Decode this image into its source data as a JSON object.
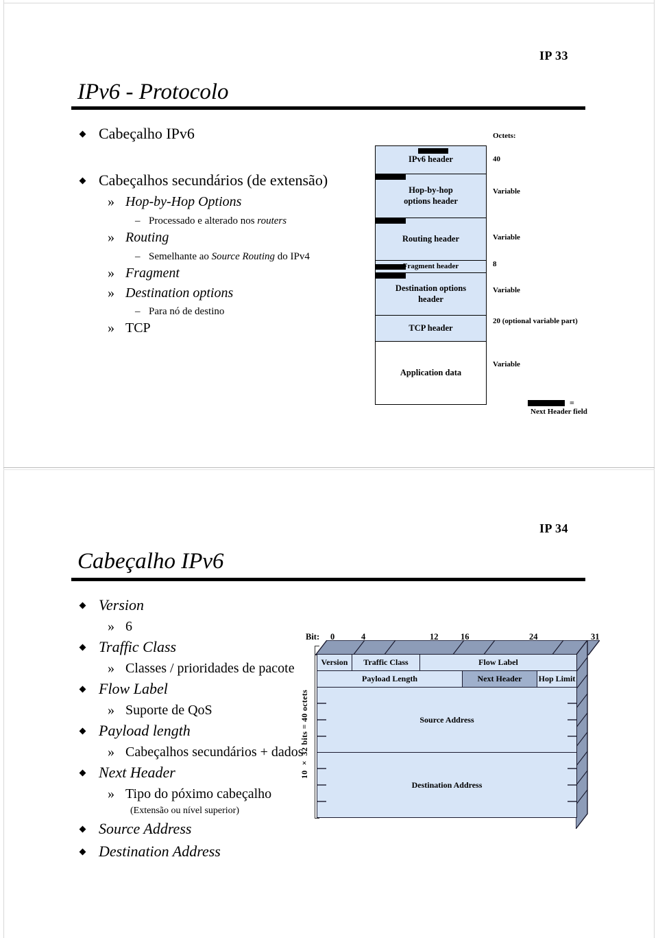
{
  "document": {
    "kind": "lecture-slides",
    "slides": [
      {
        "number_label": "IP 33",
        "title": "IPv6 - Protocolo",
        "bullets": [
          {
            "level": 1,
            "marker": "diamond",
            "text": "Cabeçalho IPv6",
            "style": "roman"
          },
          {
            "level": 1,
            "marker": "diamond",
            "text": "Cabeçalhos secundários (de extensão)",
            "style": "roman"
          },
          {
            "level": 2,
            "marker": "guillemet",
            "text": "Hop-by-Hop Options",
            "style": "italic"
          },
          {
            "level": 3,
            "marker": "dash",
            "text": "Processado e alterado nos ",
            "text_italic_tail": "routers",
            "style": "roman"
          },
          {
            "level": 2,
            "marker": "guillemet",
            "text": "Routing",
            "style": "italic"
          },
          {
            "level": 3,
            "marker": "dash",
            "text": "Semelhante ao ",
            "text_italic_mid": "Source Routing",
            "text_tail": " do IPv4",
            "style": "roman"
          },
          {
            "level": 2,
            "marker": "guillemet",
            "text": "Fragment",
            "style": "italic"
          },
          {
            "level": 2,
            "marker": "guillemet",
            "text": "Destination options",
            "style": "italic"
          },
          {
            "level": 3,
            "marker": "dash",
            "text": "Para nó de destino",
            "style": "roman"
          },
          {
            "level": 2,
            "marker": "guillemet",
            "text": "TCP",
            "style": "roman"
          }
        ],
        "diagram": {
          "type": "stack",
          "octets_header": "Octets:",
          "rows": [
            {
              "label": "IPv6 header",
              "octets": "40",
              "fill": "#d7e5f7",
              "next_header_marker": "inside-top"
            },
            {
              "label": "Hop-by-hop\noptions header",
              "octets": "Variable",
              "fill": "#d7e5f7",
              "next_header_marker": "top-left"
            },
            {
              "label": "Routing header",
              "octets": "Variable",
              "fill": "#d7e5f7",
              "next_header_marker": "top-left"
            },
            {
              "label": "Fragment header",
              "octets": "8",
              "fill": "#d7e5f7",
              "next_header_marker": "left-inline"
            },
            {
              "label": "Destination options\nheader",
              "octets": "Variable",
              "fill": "#d7e5f7",
              "next_header_marker": "top-left"
            },
            {
              "label": "TCP header",
              "octets": "20 (optional variable part)",
              "fill": "#d7e5f7",
              "next_header_marker": "none"
            },
            {
              "label": "Application data",
              "octets": "Variable",
              "fill": "#ffffff",
              "next_header_marker": "none"
            }
          ],
          "legend": {
            "equals": "=",
            "text": "Next Header field",
            "swatch_color": "#000000"
          }
        }
      },
      {
        "number_label": "IP 34",
        "title": "Cabeçalho IPv6",
        "bullets": [
          {
            "level": 1,
            "marker": "diamond",
            "text": "Version",
            "style": "italic"
          },
          {
            "level": 2,
            "marker": "guillemet",
            "text": "6",
            "style": "roman"
          },
          {
            "level": 1,
            "marker": "diamond",
            "text": "Traffic Class",
            "style": "italic"
          },
          {
            "level": 2,
            "marker": "guillemet",
            "text": "Classes / prioridades de pacote",
            "style": "roman"
          },
          {
            "level": 1,
            "marker": "diamond",
            "text": "Flow Label",
            "style": "italic"
          },
          {
            "level": 2,
            "marker": "guillemet",
            "text": "Suporte de QoS",
            "style": "roman"
          },
          {
            "level": 1,
            "marker": "diamond",
            "text": "Payload length",
            "style": "italic"
          },
          {
            "level": 2,
            "marker": "guillemet",
            "text": "Cabeçalhos secundários + dados",
            "style": "roman"
          },
          {
            "level": 1,
            "marker": "diamond",
            "text": "Next Header",
            "style": "italic"
          },
          {
            "level": 2,
            "marker": "guillemet",
            "text": "Tipo do póximo cabeçalho",
            "style": "roman"
          },
          {
            "level": 3,
            "marker": "none",
            "text": "(Extensão ou nível superior)",
            "style": "roman"
          },
          {
            "level": 1,
            "marker": "diamond",
            "text": "Source Address",
            "style": "italic"
          },
          {
            "level": 1,
            "marker": "diamond",
            "text": "Destination Address",
            "style": "italic"
          }
        ],
        "diagram": {
          "type": "packet-header",
          "bit_label": "Bit:",
          "bit_ticks": [
            "0",
            "4",
            "12",
            "16",
            "24",
            "31"
          ],
          "side_label": "10 × 32 bits = 40 octets",
          "fields": [
            {
              "name": "Version",
              "bits": "0-3",
              "highlight": false
            },
            {
              "name": "Traffic Class",
              "bits": "4-11",
              "highlight": false
            },
            {
              "name": "Flow Label",
              "bits": "12-31",
              "highlight": false
            },
            {
              "name": "Payload Length",
              "bits": "0-15",
              "highlight": false
            },
            {
              "name": "Next Header",
              "bits": "16-23",
              "highlight": true
            },
            {
              "name": "Hop Limit",
              "bits": "24-31",
              "highlight": false
            },
            {
              "name": "Source Address",
              "bits": "128 bits",
              "highlight": false
            },
            {
              "name": "Destination Address",
              "bits": "128 bits",
              "highlight": false
            }
          ],
          "colors": {
            "cell_fill": "#d7e5f7",
            "highlight_fill": "#9fb0cc",
            "side_3d_fill": "#8d9cb8",
            "border": "#1a1a2e"
          }
        }
      }
    ]
  }
}
